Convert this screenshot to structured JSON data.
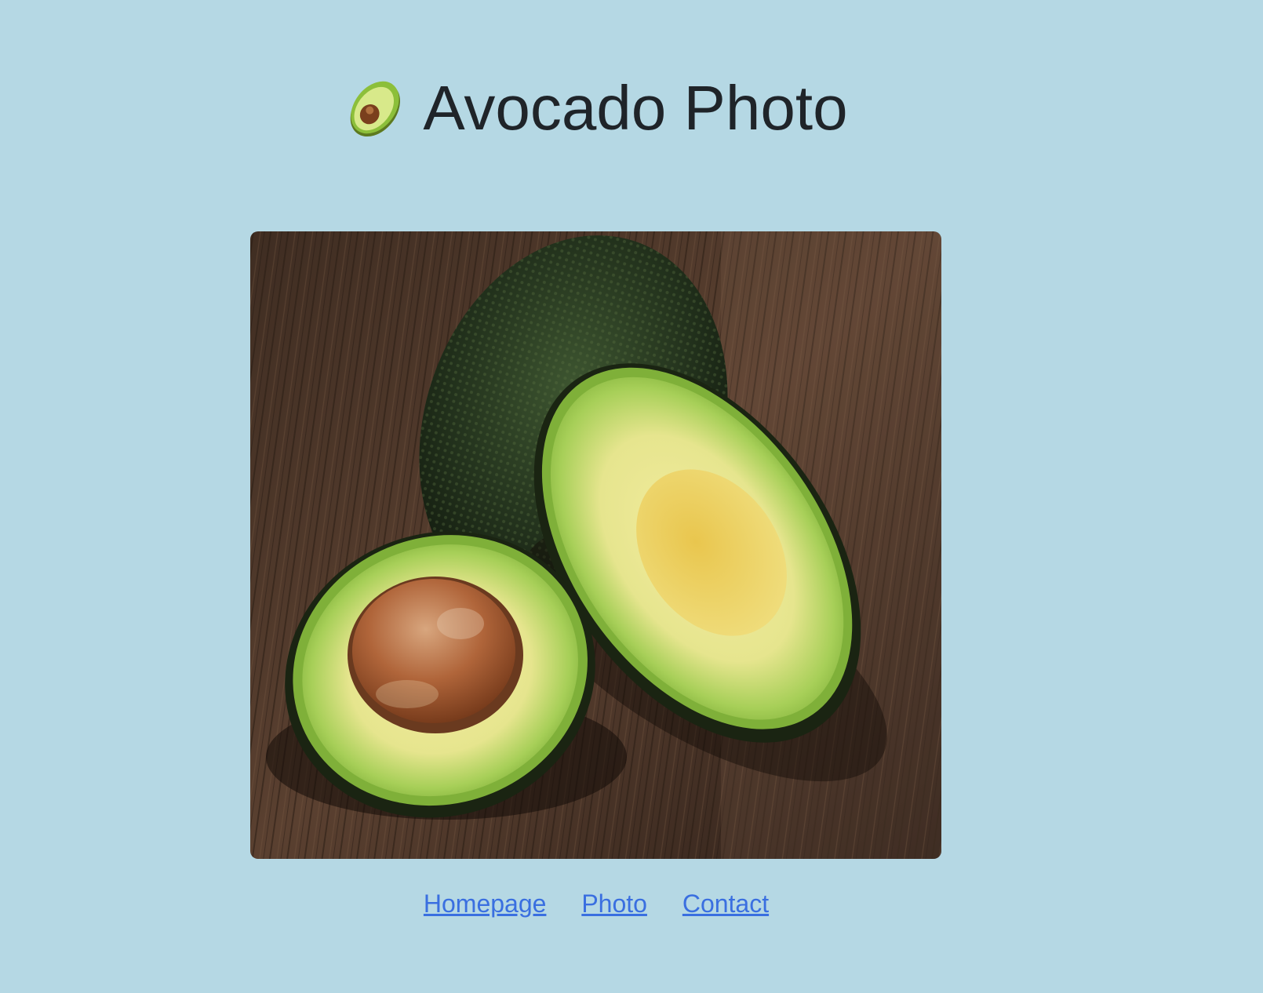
{
  "header": {
    "title": "Avocado Photo",
    "icon": "avocado-icon"
  },
  "photo": {
    "subject": "avocado-photo"
  },
  "nav": {
    "links": [
      {
        "label": "Homepage"
      },
      {
        "label": "Photo"
      },
      {
        "label": "Contact"
      }
    ]
  },
  "colors": {
    "background": "#b5d8e4",
    "title_text": "#1f2429",
    "link": "#3a6fe0"
  }
}
